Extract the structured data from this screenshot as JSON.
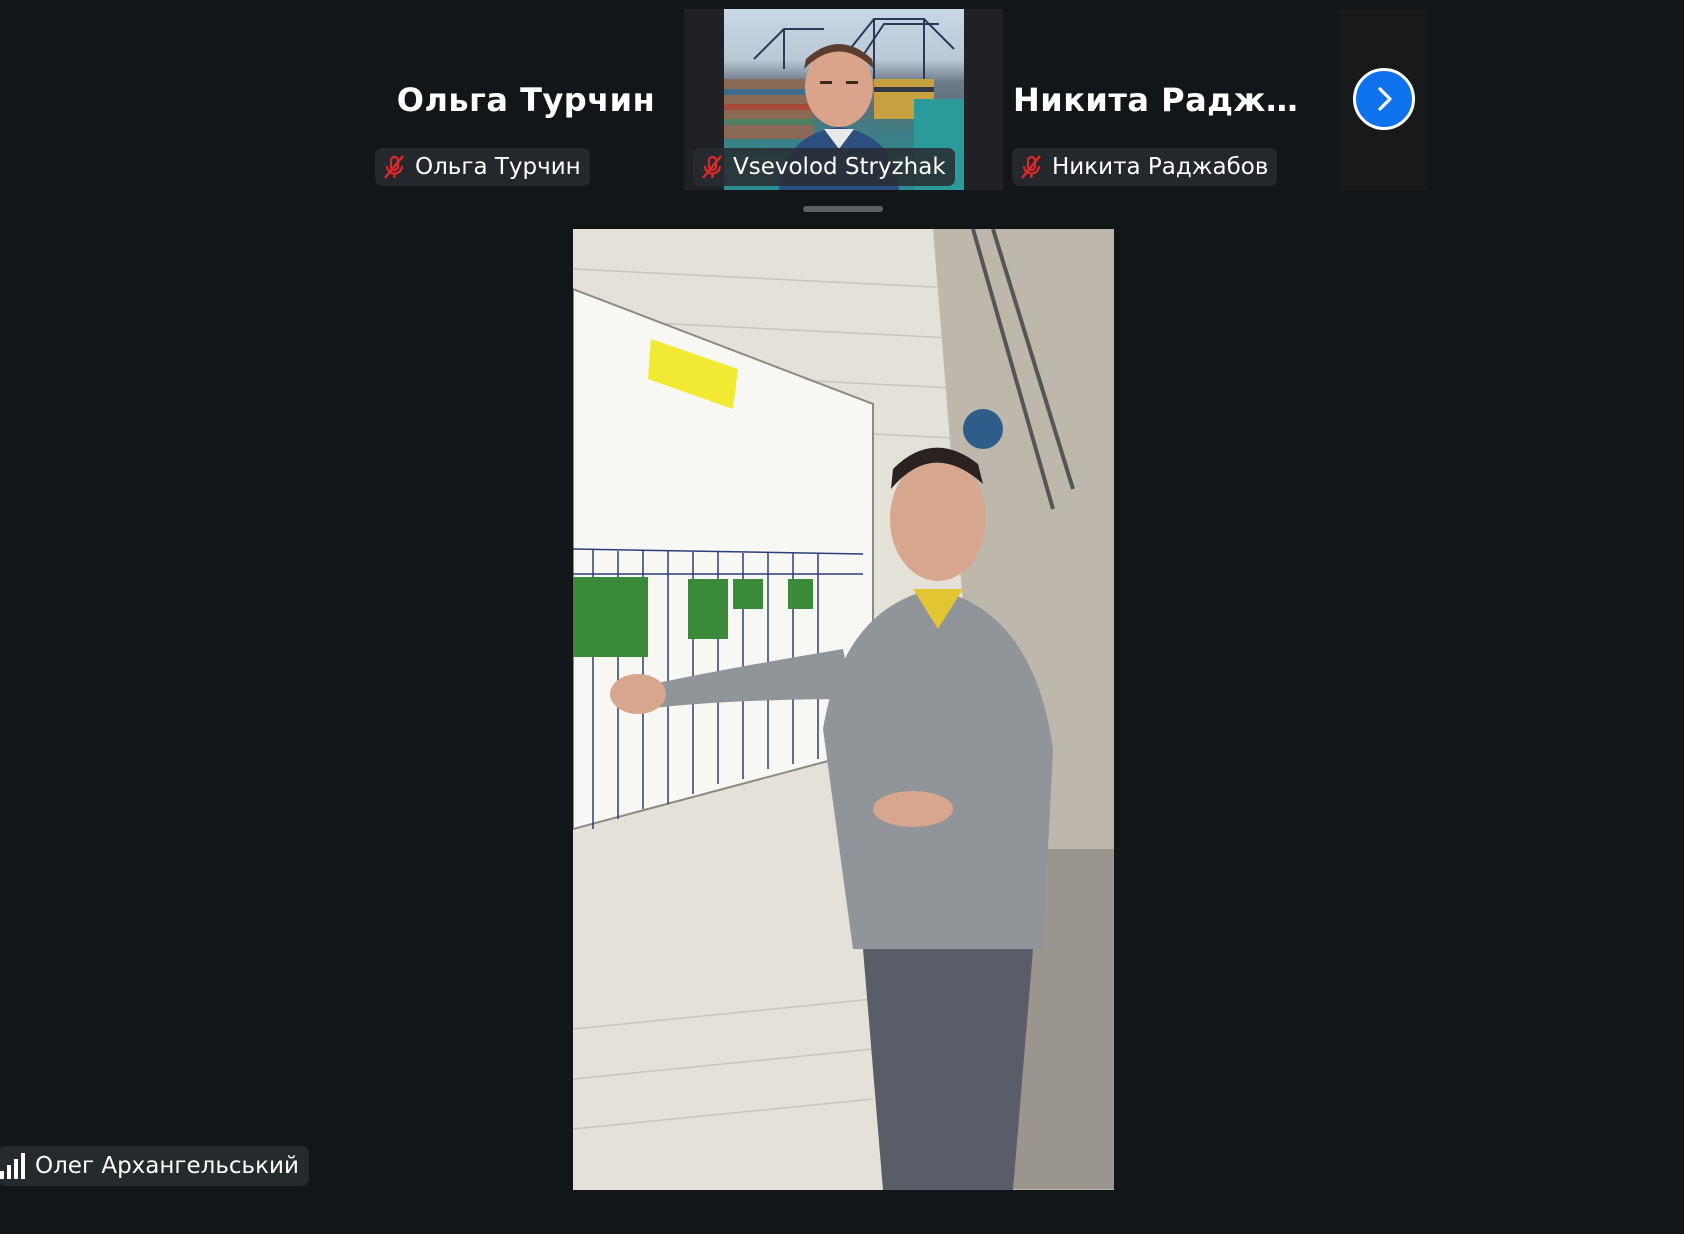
{
  "participants_strip": {
    "tiles": [
      {
        "display_name": "Ольга Турчин",
        "label": "Ольга Турчин",
        "muted": true,
        "video": false
      },
      {
        "display_name": "",
        "label": "Vsevolod Stryzhak",
        "muted": true,
        "video": true
      },
      {
        "display_name": "Никита  Раджаб...",
        "label": "Никита Раджабов",
        "muted": true,
        "video": false
      }
    ],
    "next_button_icon": "chevron-right-icon"
  },
  "active_speaker": {
    "label": "Олег Архангельський",
    "signal_icon": "signal-bars-icon"
  },
  "colors": {
    "background": "#131619",
    "accent_blue": "#0e72ed",
    "muted_red": "#e02828"
  }
}
